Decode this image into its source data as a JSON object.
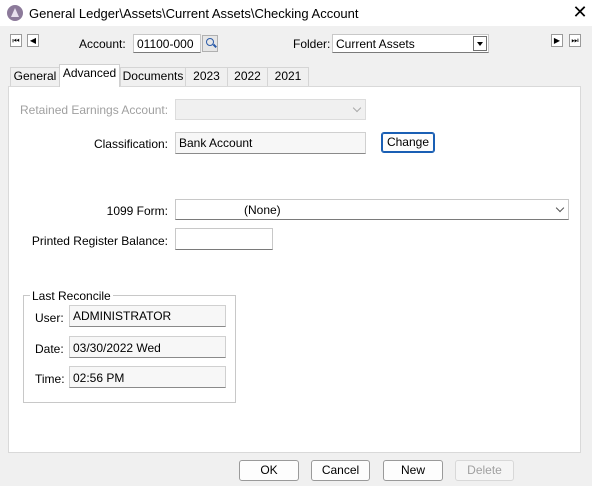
{
  "window": {
    "title": "General Ledger\\Assets\\Current Assets\\Checking Account",
    "close_glyph": "✕"
  },
  "nav": {
    "first_glyph": "⏮",
    "prev_glyph": "◀",
    "next_glyph": "▶",
    "last_glyph": "⏭"
  },
  "account": {
    "label": "Account:",
    "value": "01100-000"
  },
  "folder": {
    "label": "Folder:",
    "value": "Current Assets"
  },
  "tabs": [
    {
      "label": "General"
    },
    {
      "label": "Advanced"
    },
    {
      "label": "Documents"
    },
    {
      "label": "2023"
    },
    {
      "label": "2022"
    },
    {
      "label": "2021"
    }
  ],
  "advanced": {
    "retained_label": "Retained Earnings Account:",
    "retained_value": "",
    "classification_label": "Classification:",
    "classification_value": "Bank Account",
    "change_label": "Change",
    "form1099_label": "1099 Form:",
    "form1099_value": "(None)",
    "printed_balance_label": "Printed Register Balance:",
    "printed_balance_value": ""
  },
  "last_reconcile": {
    "title": "Last Reconcile",
    "user_label": "User:",
    "user_value": "ADMINISTRATOR",
    "date_label": "Date:",
    "date_value": "03/30/2022 Wed",
    "time_label": "Time:",
    "time_value": "02:56 PM"
  },
  "buttons": {
    "ok": "OK",
    "cancel": "Cancel",
    "new": "New",
    "delete": "Delete"
  },
  "colors": {
    "accent": "#1a5fb4",
    "panel": "#ffffff",
    "background": "#f0f0f0",
    "disabled_text": "#a0a0a0"
  }
}
